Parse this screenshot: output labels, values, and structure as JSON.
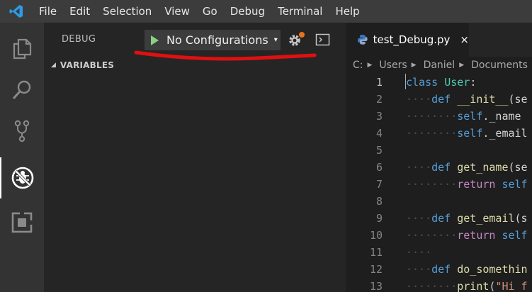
{
  "menu": {
    "items": [
      "File",
      "Edit",
      "Selection",
      "View",
      "Go",
      "Debug",
      "Terminal",
      "Help"
    ]
  },
  "activity_bar": {
    "items": [
      {
        "icon": "explorer-icon"
      },
      {
        "icon": "search-icon"
      },
      {
        "icon": "source-control-icon"
      },
      {
        "icon": "debug-icon",
        "active": true
      },
      {
        "icon": "extensions-icon"
      }
    ]
  },
  "debug": {
    "title": "DEBUG",
    "config_label": "No Configurations",
    "config_caret": "▾",
    "variables_caret": "◢",
    "variables_title": "VARIABLES",
    "annotation_color": "#e01010"
  },
  "editor": {
    "tab_label": "test_Debug.py",
    "tab_close": "×",
    "breadcrumb": [
      "C:",
      "Users",
      "Daniel",
      "Documents"
    ],
    "lines": [
      {
        "n": "1",
        "ws": "",
        "tokens": [
          [
            "kw",
            "class"
          ],
          [
            "plain",
            " "
          ],
          [
            "cls",
            "User"
          ],
          [
            "plain",
            ":"
          ]
        ]
      },
      {
        "n": "2",
        "ws": "····",
        "tokens": [
          [
            "kw",
            "def"
          ],
          [
            "plain",
            " "
          ],
          [
            "fn",
            "__init__"
          ],
          [
            "plain",
            "(se"
          ]
        ]
      },
      {
        "n": "3",
        "ws": "········",
        "tokens": [
          [
            "slf",
            "self"
          ],
          [
            "plain",
            "._name"
          ]
        ]
      },
      {
        "n": "4",
        "ws": "········",
        "tokens": [
          [
            "slf",
            "self"
          ],
          [
            "plain",
            "._email"
          ]
        ]
      },
      {
        "n": "5",
        "ws": "",
        "tokens": []
      },
      {
        "n": "6",
        "ws": "····",
        "tokens": [
          [
            "kw",
            "def"
          ],
          [
            "plain",
            " "
          ],
          [
            "fn",
            "get_name"
          ],
          [
            "plain",
            "(se"
          ]
        ]
      },
      {
        "n": "7",
        "ws": "········",
        "tokens": [
          [
            "ret",
            "return"
          ],
          [
            "plain",
            " "
          ],
          [
            "slf",
            "self"
          ]
        ]
      },
      {
        "n": "8",
        "ws": "",
        "tokens": []
      },
      {
        "n": "9",
        "ws": "····",
        "tokens": [
          [
            "kw",
            "def"
          ],
          [
            "plain",
            " "
          ],
          [
            "fn",
            "get_email"
          ],
          [
            "plain",
            "(s"
          ]
        ]
      },
      {
        "n": "10",
        "ws": "········",
        "tokens": [
          [
            "ret",
            "return"
          ],
          [
            "plain",
            " "
          ],
          [
            "slf",
            "self"
          ]
        ]
      },
      {
        "n": "11",
        "ws": "····",
        "tokens": []
      },
      {
        "n": "12",
        "ws": "····",
        "tokens": [
          [
            "kw",
            "def"
          ],
          [
            "plain",
            " "
          ],
          [
            "fn",
            "do_somethin"
          ]
        ]
      },
      {
        "n": "13",
        "ws": "········",
        "tokens": [
          [
            "fn",
            "print"
          ],
          [
            "plain",
            "("
          ],
          [
            "str",
            "\"Hi f"
          ]
        ]
      }
    ]
  }
}
